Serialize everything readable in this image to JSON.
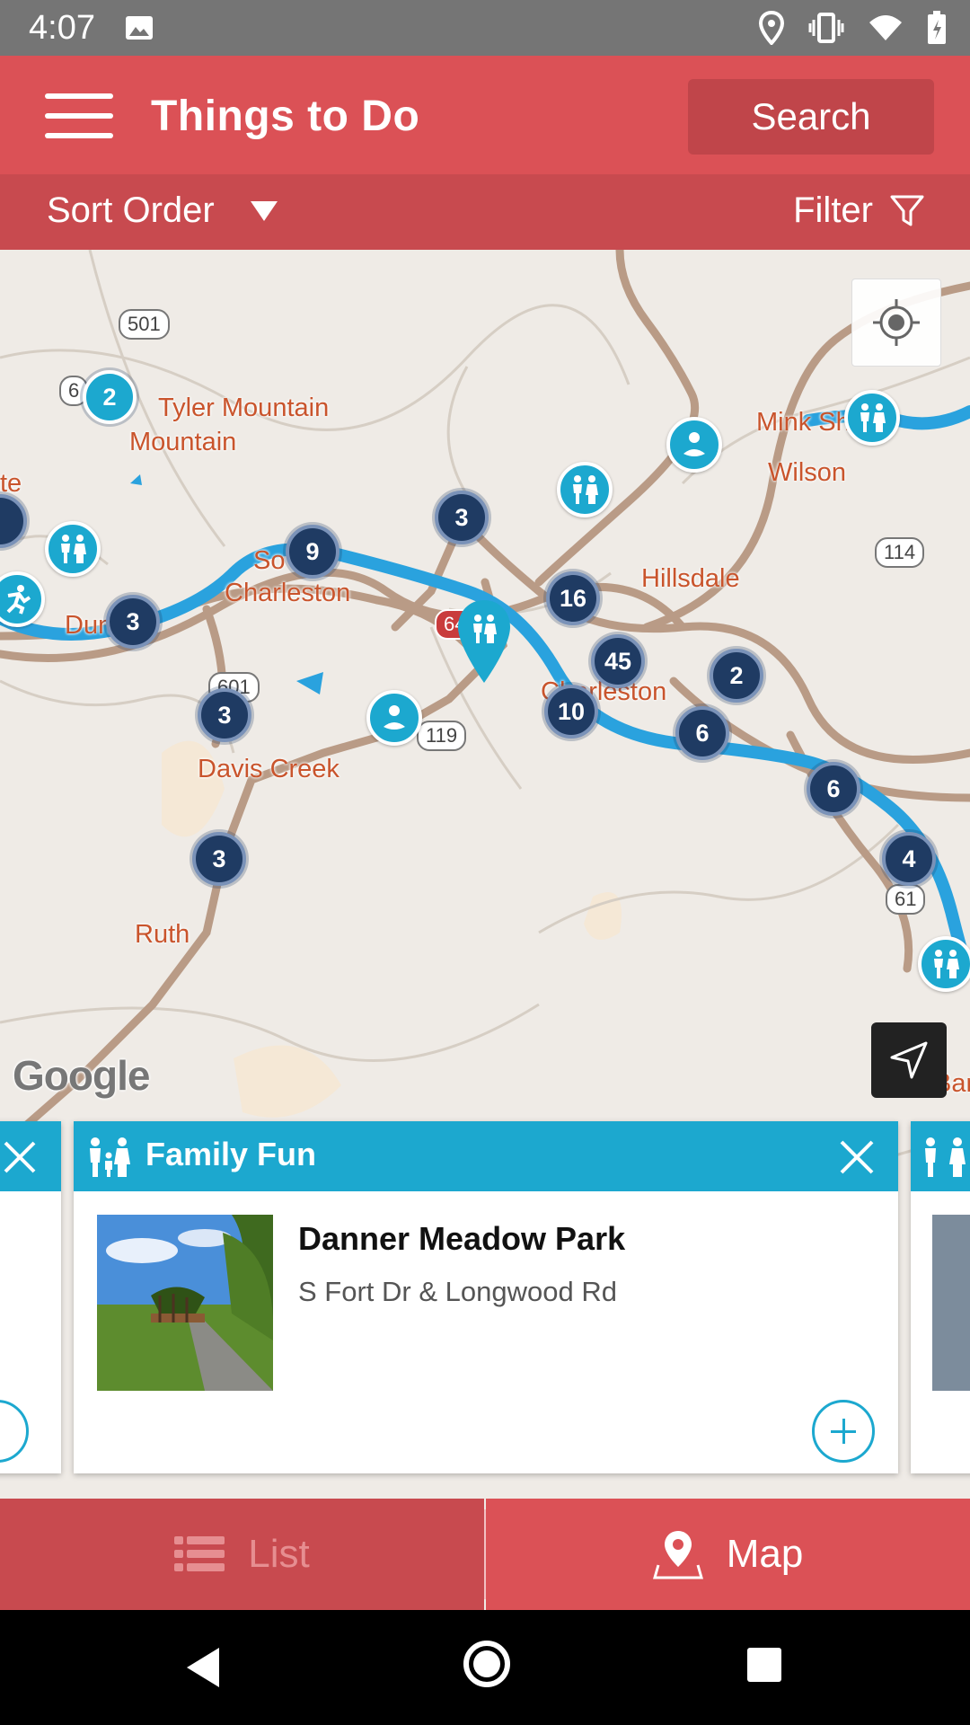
{
  "status_bar": {
    "time": "4:07"
  },
  "app_bar": {
    "title": "Things to Do",
    "search_label": "Search"
  },
  "sort_bar": {
    "sort_label": "Sort Order",
    "filter_label": "Filter"
  },
  "map": {
    "place_labels": [
      "Tyler Mountain",
      "Mink Sh",
      "Wilson",
      "Hillsdale",
      "So",
      "Charleston",
      "Dun",
      "Charleston",
      "Davis Creek",
      "Ruth",
      "te",
      "Ban"
    ],
    "route_shields": [
      "501",
      "64",
      "601",
      "119",
      "114",
      "61",
      "6"
    ],
    "clusters": [
      "2",
      "3",
      "9",
      "3",
      "16",
      "45",
      "2",
      "10",
      "6",
      "3",
      "6",
      "3",
      "4"
    ],
    "attribution": "Google",
    "accent_color": "#1ca8cf",
    "cluster_color": "#1f3b63"
  },
  "card": {
    "category": "Family Fun",
    "name": "Danner Meadow Park",
    "address": "S Fort Dr & Longwood Rd",
    "header_color": "#1ca8cf"
  },
  "bottom_tabs": {
    "list_label": "List",
    "map_label": "Map",
    "active": "Map"
  },
  "brand_color": "#db5156"
}
